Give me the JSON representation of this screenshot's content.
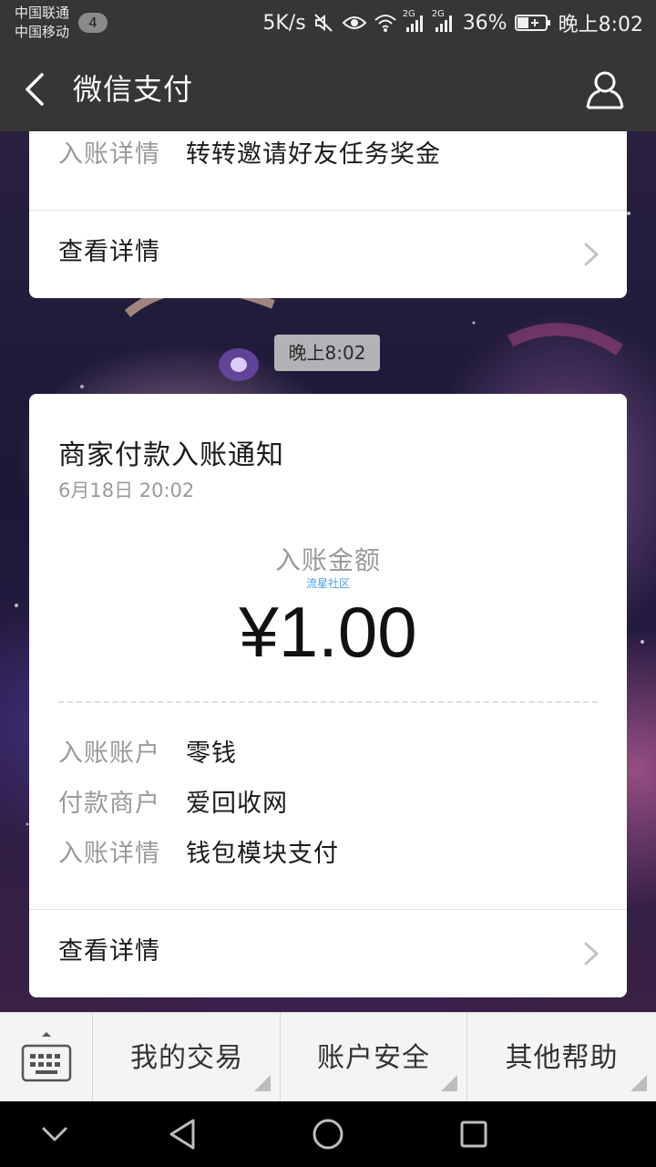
{
  "status_bar": {
    "carrier_1": "中国联通",
    "carrier_2": "中国移动",
    "notification_count": "4",
    "network_speed": "5K/s",
    "signal_1_tag": "2G",
    "signal_2_tag": "2G",
    "battery_percent": "36%",
    "time": "晚上8:02"
  },
  "title_bar": {
    "title": "微信支付",
    "back_icon": "back-chevron-icon",
    "profile_icon": "person-icon"
  },
  "card_top": {
    "detail_key": "入账详情",
    "detail_value": "转转邀请好友任务奖金",
    "view_details": "查看详情"
  },
  "time_chip": "晚上8:02",
  "card_main": {
    "title": "商家付款入账通知",
    "datetime": "6月18日  20:02",
    "amount_label": "入账金额",
    "watermark": "流星社区",
    "amount": "¥1.00",
    "rows": [
      {
        "key": "入账账户",
        "value": "零钱"
      },
      {
        "key": "付款商户",
        "value": "爱回收网"
      },
      {
        "key": "入账详情",
        "value": "钱包模块支付"
      }
    ],
    "view_details": "查看详情"
  },
  "bottom_menu": {
    "keyboard_icon": "keyboard-icon",
    "items": [
      "我的交易",
      "账户安全",
      "其他帮助"
    ]
  },
  "colors": {
    "header_bg": "#363636",
    "card_bg": "#ffffff",
    "muted_text": "#9a9a9a",
    "watermark": "#4aa0e6"
  }
}
